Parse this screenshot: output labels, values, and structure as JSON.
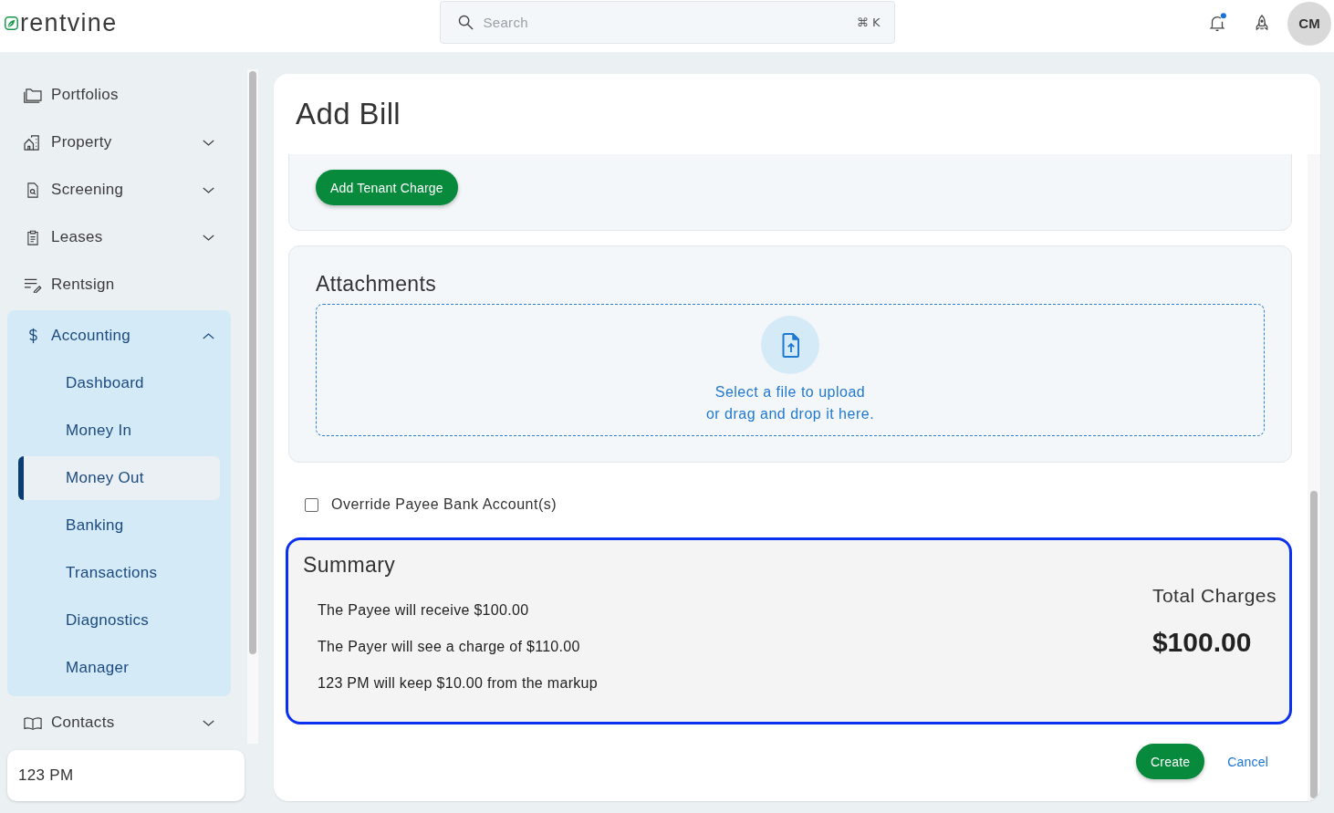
{
  "header": {
    "logo": "rentvine",
    "search": {
      "placeholder": "Search",
      "shortcut": "⌘ K"
    },
    "notifications": {
      "unread": true
    },
    "avatar": "CM"
  },
  "sidebar": {
    "items": [
      {
        "label": "Portfolios",
        "kind": "link"
      },
      {
        "label": "Property",
        "kind": "group",
        "expanded": false
      },
      {
        "label": "Screening",
        "kind": "group",
        "expanded": false
      },
      {
        "label": "Leases",
        "kind": "group",
        "expanded": false
      },
      {
        "label": "Rentsign",
        "kind": "link"
      },
      {
        "label": "Accounting",
        "kind": "group",
        "expanded": true,
        "children": [
          {
            "label": "Dashboard",
            "selected": false
          },
          {
            "label": "Money In",
            "selected": false
          },
          {
            "label": "Money Out",
            "selected": true
          },
          {
            "label": "Banking",
            "selected": false
          },
          {
            "label": "Transactions",
            "selected": false
          },
          {
            "label": "Diagnostics",
            "selected": false
          },
          {
            "label": "Manager",
            "selected": false
          }
        ]
      },
      {
        "label": "Contacts",
        "kind": "group",
        "expanded": false
      }
    ],
    "company": "123 PM"
  },
  "page": {
    "title": "Add Bill",
    "tenant_charges": {
      "add_button": "Add Tenant Charge"
    },
    "attachments": {
      "title": "Attachments",
      "upload_prompt": "Select a file to upload\nor drag and drop it here."
    },
    "override_bank": {
      "label": "Override Payee Bank Account(s)",
      "checked": false
    },
    "summary": {
      "title": "Summary",
      "lines": [
        "The Payee will receive $100.00",
        "The Payer will see a charge of $110.00",
        "123 PM will keep $10.00 from the markup"
      ],
      "total_label": "Total Charges",
      "total": "$100.00"
    },
    "actions": [
      {
        "label": "Create",
        "kind": "primary"
      },
      {
        "label": "Cancel",
        "kind": "link"
      }
    ]
  }
}
